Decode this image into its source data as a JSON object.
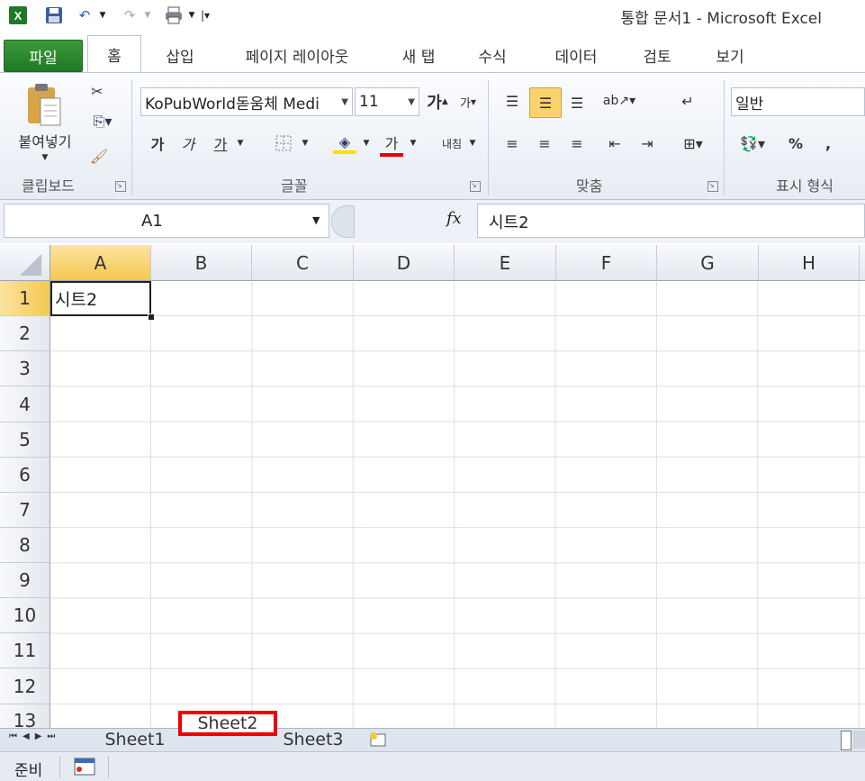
{
  "window": {
    "title": "통합 문서1 - Microsoft Excel"
  },
  "colors": {
    "file_tab": "#2a8a30",
    "highlight": "#ff0000",
    "active_header": "#f9d36b",
    "accent_font_red": "#e00000",
    "accent_fill_yellow": "#ffe000"
  },
  "qat": {
    "icons": [
      "excel-icon",
      "save-icon",
      "undo-icon",
      "redo-icon",
      "print-icon",
      "customize-icon"
    ]
  },
  "tabs": [
    {
      "label": "파일"
    },
    {
      "label": "홈"
    },
    {
      "label": "삽입"
    },
    {
      "label": "페이지 레이아웃"
    },
    {
      "label": "새 탭"
    },
    {
      "label": "수식"
    },
    {
      "label": "데이터"
    },
    {
      "label": "검토"
    },
    {
      "label": "보기"
    }
  ],
  "ribbon": {
    "paste_label": "붙여넣기",
    "font_name": "KoPubWorld돋움체 Medi",
    "font_size": "11",
    "bold": "가",
    "italic": "가",
    "underline": "가",
    "font_color": "가",
    "grow_font": "가",
    "shrink_font": "가",
    "wrap_text": "내침",
    "number_format": "일반",
    "percent": "%",
    "comma": ",",
    "groups": {
      "clipboard": "클립보드",
      "font": "글꼴",
      "alignment": "맞춤",
      "number": "표시 형식"
    }
  },
  "formula_bar": {
    "name_box": "A1",
    "fx": "fx",
    "content": "시트2"
  },
  "grid": {
    "columns": [
      "A",
      "B",
      "C",
      "D",
      "E",
      "F",
      "G",
      "H"
    ],
    "rows": [
      "1",
      "2",
      "3",
      "4",
      "5",
      "6",
      "7",
      "8",
      "9",
      "10",
      "11",
      "12",
      "13"
    ],
    "cell_A1": "시트2",
    "active_cell": "A1"
  },
  "sheets": {
    "tabs": [
      "Sheet1",
      "Sheet2",
      "Sheet3"
    ],
    "active": "Sheet2"
  },
  "status": {
    "ready": "준비"
  }
}
